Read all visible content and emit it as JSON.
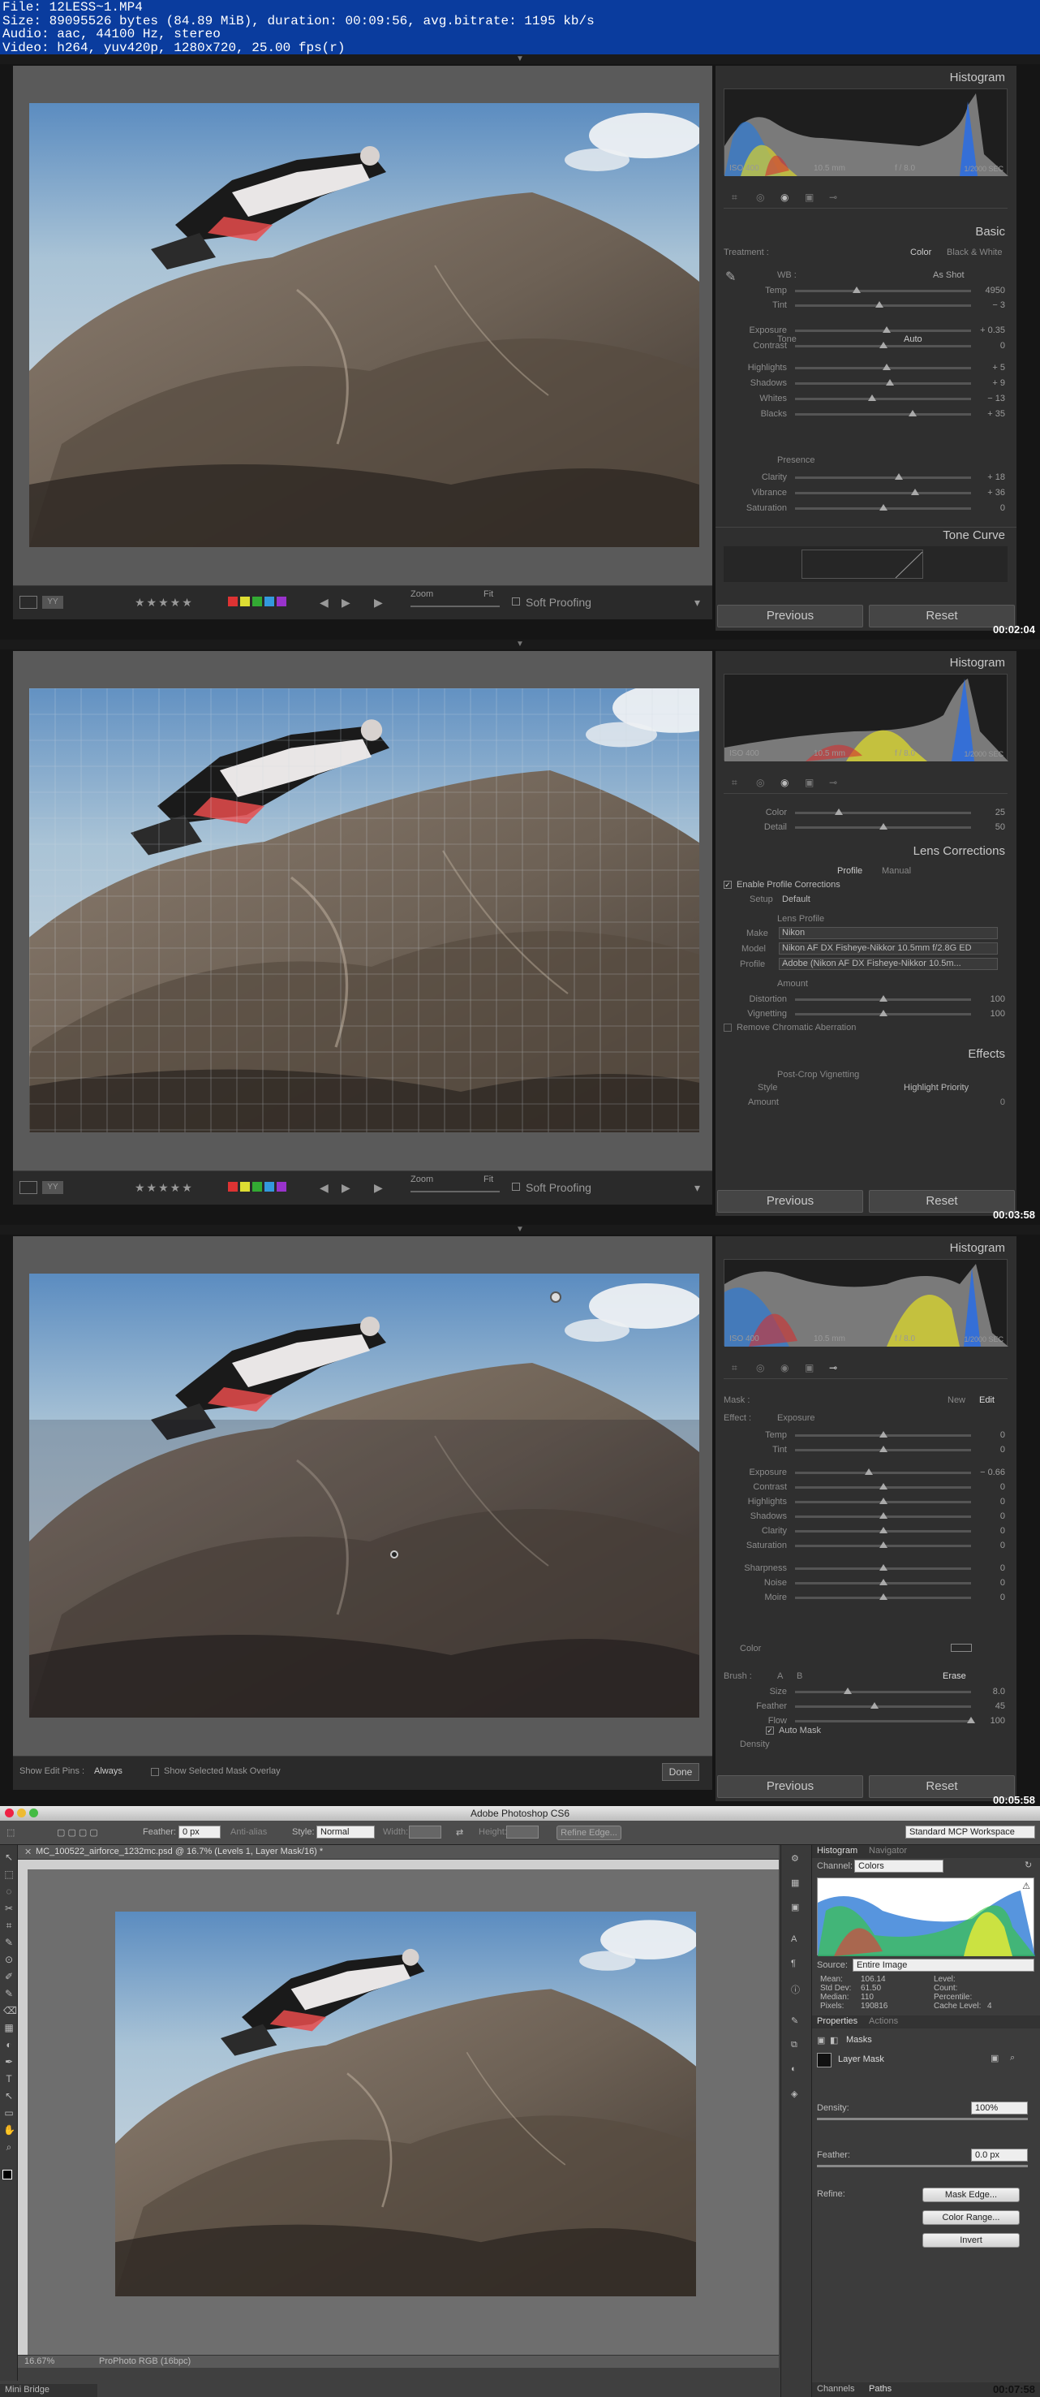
{
  "file_info": {
    "line1": "File: 12LESS~1.MP4",
    "line2": "Size: 89095526 bytes (84.89 MiB), duration: 00:09:56, avg.bitrate: 1195 kb/s",
    "line3": "Audio: aac, 44100 Hz, stereo",
    "line4": "Video: h264, yuv420p, 1280x720, 25.00 fps(r)"
  },
  "colors": {
    "lr_bg": "#2f2f2f",
    "ps_bg": "#404040",
    "header_bg": "#0a3c9e"
  },
  "frames": [
    {
      "timestamp": "00:02:04",
      "histogram": {
        "title": "Histogram",
        "iso": "ISO 400",
        "focal": "10.5 mm",
        "aperture": "f / 8.0",
        "shutter": "1/2000 SEC"
      },
      "panel_title": "Basic",
      "treatment_label": "Treatment :",
      "color_label": "Color",
      "bw_label": "Black & White",
      "wb_label": "WB :",
      "wb_value": "As Shot",
      "tone_label": "Tone",
      "auto_label": "Auto",
      "presence_label": "Presence",
      "sliders": [
        {
          "label": "Temp",
          "value": "4950",
          "pos": 0.35
        },
        {
          "label": "Tint",
          "value": "− 3",
          "pos": 0.48
        },
        {
          "label": "Exposure",
          "value": "+ 0.35",
          "pos": 0.52
        },
        {
          "label": "Contrast",
          "value": "0",
          "pos": 0.5
        },
        {
          "label": "Highlights",
          "value": "+ 5",
          "pos": 0.52
        },
        {
          "label": "Shadows",
          "value": "+ 9",
          "pos": 0.54
        },
        {
          "label": "Whites",
          "value": "− 13",
          "pos": 0.44
        },
        {
          "label": "Blacks",
          "value": "+ 35",
          "pos": 0.67
        },
        {
          "label": "Clarity",
          "value": "+ 18",
          "pos": 0.59
        },
        {
          "label": "Vibrance",
          "value": "+ 36",
          "pos": 0.68
        },
        {
          "label": "Saturation",
          "value": "0",
          "pos": 0.5
        }
      ],
      "next_panel": "Tone Curve",
      "previous": "Previous",
      "reset": "Reset",
      "zoom_label": "Zoom",
      "fit_label": "Fit",
      "soft_proofing": "Soft Proofing"
    },
    {
      "timestamp": "00:03:58",
      "histogram": {
        "title": "Histogram",
        "iso": "ISO 400",
        "focal": "10.5 mm",
        "aperture": "f / 8.0",
        "shutter": "1/2000 SEC"
      },
      "detail_sliders": [
        {
          "label": "Color",
          "value": "25",
          "pos": 0.25
        },
        {
          "label": "Detail",
          "value": "50",
          "pos": 0.5
        }
      ],
      "panel_title": "Lens Corrections",
      "tab_profile": "Profile",
      "tab_manual": "Manual",
      "enable_profile": "Enable Profile Corrections",
      "setup_label": "Setup",
      "setup_value": "Default",
      "lens_profile_label": "Lens Profile",
      "make_label": "Make",
      "make_value": "Nikon",
      "model_label": "Model",
      "model_value": "Nikon AF DX Fisheye-Nikkor 10.5mm f/2.8G ED",
      "profile_label": "Profile",
      "profile_value": "Adobe (Nikon AF DX Fisheye-Nikkor 10.5m...",
      "amount_label": "Amount",
      "amount_sliders": [
        {
          "label": "Distortion",
          "value": "100",
          "pos": 0.5
        },
        {
          "label": "Vignetting",
          "value": "100",
          "pos": 0.5
        }
      ],
      "remove_ca": "Remove Chromatic Aberration",
      "effects_title": "Effects",
      "post_crop": "Post-Crop Vignetting",
      "style_label": "Style",
      "style_value": "Highlight Priority",
      "amount2_label": "Amount",
      "amount2_value": "0",
      "previous": "Previous",
      "reset": "Reset",
      "zoom_label": "Zoom",
      "fit_label": "Fit",
      "soft_proofing": "Soft Proofing"
    },
    {
      "timestamp": "00:05:58",
      "histogram": {
        "title": "Histogram",
        "iso": "ISO 400",
        "focal": "10.5 mm",
        "aperture": "f / 8.0",
        "shutter": "1/2000 SEC"
      },
      "mask_label": "Mask :",
      "new_label": "New",
      "edit_label": "Edit",
      "effect_label": "Effect :",
      "effect_value": "Exposure",
      "sliders": [
        {
          "label": "Temp",
          "value": "0",
          "pos": 0.5
        },
        {
          "label": "Tint",
          "value": "0",
          "pos": 0.5
        },
        {
          "label": "Exposure",
          "value": "− 0.66",
          "pos": 0.42
        },
        {
          "label": "Contrast",
          "value": "0",
          "pos": 0.5
        },
        {
          "label": "Highlights",
          "value": "0",
          "pos": 0.5
        },
        {
          "label": "Shadows",
          "value": "0",
          "pos": 0.5
        },
        {
          "label": "Clarity",
          "value": "0",
          "pos": 0.5
        },
        {
          "label": "Saturation",
          "value": "0",
          "pos": 0.5
        },
        {
          "label": "Sharpness",
          "value": "0",
          "pos": 0.5
        },
        {
          "label": "Noise",
          "value": "0",
          "pos": 0.5
        },
        {
          "label": "Moire",
          "value": "0",
          "pos": 0.5
        }
      ],
      "color_label": "Color",
      "brush_label": "Brush :",
      "brush_a": "A",
      "brush_b": "B",
      "erase": "Erase",
      "brush_sliders": [
        {
          "label": "Size",
          "value": "8.0",
          "pos": 0.3
        },
        {
          "label": "Feather",
          "value": "45",
          "pos": 0.45
        },
        {
          "label": "Flow",
          "value": "100",
          "pos": 1.0
        }
      ],
      "auto_mask": "Auto Mask",
      "density_label": "Density",
      "show_edit_pins": "Show Edit Pins :",
      "edit_pins_value": "Always",
      "show_mask_overlay": "Show Selected Mask Overlay",
      "done": "Done",
      "previous": "Previous",
      "reset": "Reset"
    }
  ],
  "photoshop": {
    "title": "Adobe Photoshop CS6",
    "feather_label": "Feather:",
    "feather_value": "0 px",
    "antialias": "Anti-alias",
    "style_label": "Style:",
    "style_value": "Normal",
    "width_label": "Width:",
    "height_label": "Height:",
    "refine_edge": "Refine Edge...",
    "workspace": "Standard MCP Workspace",
    "doc_tab": "MC_100522_airforce_1232mc.psd @ 16.7% (Levels 1, Layer Mask/16) *",
    "zoom": "16.67%",
    "doc_profile": "ProPhoto RGB (16bpc)",
    "tab_histogram": "Histogram",
    "tab_navigator": "Navigator",
    "channel_label": "Channel:",
    "channel_value": "Colors",
    "source_label": "Source:",
    "source_value": "Entire Image",
    "stats": [
      {
        "k": "Mean:",
        "v": "106.14"
      },
      {
        "k": "Std Dev:",
        "v": "61.50"
      },
      {
        "k": "Median:",
        "v": "110"
      },
      {
        "k": "Pixels:",
        "v": "190816"
      }
    ],
    "stats2": [
      {
        "k": "Level:"
      },
      {
        "k": "Count:"
      },
      {
        "k": "Percentile:"
      },
      {
        "k": "Cache Level:",
        "v": "4"
      }
    ],
    "tab_properties": "Properties",
    "tab_actions": "Actions",
    "masks_label": "Masks",
    "layer_mask": "Layer Mask",
    "density_label": "Density:",
    "density_value": "100%",
    "feather_label2": "Feather:",
    "feather_value2": "0.0 px",
    "refine_label": "Refine:",
    "mask_edge": "Mask Edge...",
    "color_range": "Color Range...",
    "invert": "Invert",
    "tab_channels": "Channels",
    "tab_paths": "Paths",
    "mini_bridge": "Mini Bridge",
    "timestamp": "00:07:58"
  }
}
